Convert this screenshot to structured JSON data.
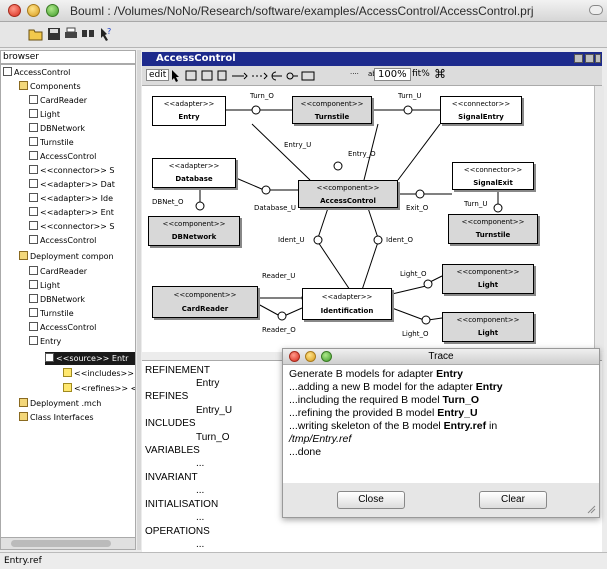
{
  "window": {
    "title": "Bouml : /Volumes/NoNo/Research/software/examples/AccessControl/AccessControl.prj"
  },
  "toolbar": {
    "icons": [
      "open-icon",
      "save-icon",
      "print-icon",
      "find-icon",
      "help-icon"
    ]
  },
  "browser": {
    "label": "browser",
    "items": [
      {
        "label": "AccessControl"
      },
      {
        "label": "Components"
      },
      {
        "label": "CardReader"
      },
      {
        "label": "Light"
      },
      {
        "label": "DBNetwork"
      },
      {
        "label": "Turnstile"
      },
      {
        "label": "AccessControl"
      },
      {
        "label": "<<connector>> S"
      },
      {
        "label": "<<adapter>> Dat"
      },
      {
        "label": "<<adapter>> Ide"
      },
      {
        "label": "<<adapter>> Ent"
      },
      {
        "label": "<<connector>> S"
      },
      {
        "label": "AccessControl"
      },
      {
        "label": "Deployment compon"
      },
      {
        "label": "CardReader"
      },
      {
        "label": "Light"
      },
      {
        "label": "DBNetwork"
      },
      {
        "label": "Turnstile"
      },
      {
        "label": "AccessControl"
      },
      {
        "label": "Entry"
      },
      {
        "label": "<<source>> Entr"
      },
      {
        "label": "<<includes>>"
      },
      {
        "label": "<<refines>> <"
      },
      {
        "label": "Deployment .mch"
      },
      {
        "label": "Class Interfaces"
      }
    ]
  },
  "diagram": {
    "title": "AccessControl",
    "toolbar": {
      "edit": "edit",
      "zoom": "100%",
      "fit": "fit%"
    },
    "components": [
      {
        "stereo": "<<adapter>>",
        "name": "Entry"
      },
      {
        "stereo": "<<component>>",
        "name": "Turnstile"
      },
      {
        "stereo": "<<connector>>",
        "name": "SignalEntry"
      },
      {
        "stereo": "<<adapter>>",
        "name": "Database"
      },
      {
        "stereo": "<<component>>",
        "name": "AccessControl"
      },
      {
        "stereo": "<<connector>>",
        "name": "SignalExit"
      },
      {
        "stereo": "<<component>>",
        "name": "DBNetwork"
      },
      {
        "stereo": "<<component>>",
        "name": "Turnstile"
      },
      {
        "stereo": "<<component>>",
        "name": "Light"
      },
      {
        "stereo": "<<component>>",
        "name": "CardReader"
      },
      {
        "stereo": "<<adapter>>",
        "name": "Identification"
      },
      {
        "stereo": "<<component>>",
        "name": "Light"
      }
    ],
    "labels": [
      "Turn_O",
      "Turn_U",
      "Entry_U",
      "Entry_O",
      "DBNet_O",
      "Database_U",
      "Exit_O",
      "Turn_U",
      "Ident_U",
      "Ident_O",
      "Reader_U",
      "Reader_O",
      "Light_O",
      "Light_O"
    ]
  },
  "lower_panel": {
    "lines": [
      "REFINEMENT",
      "Entry",
      "REFINES",
      "Entry_U",
      "INCLUDES",
      "Turn_O",
      "VARIABLES",
      "...",
      "INVARIANT",
      "...",
      "INITIALISATION",
      "...",
      "OPERATIONS",
      "..."
    ]
  },
  "trace": {
    "title": "Trace",
    "lines": [
      {
        "pre": "Generate B models for adapter ",
        "bold": "Entry",
        "post": "",
        "italic": false
      },
      {
        "pre": "...adding a new B model for the adapter ",
        "bold": "Entry",
        "post": "",
        "italic": false
      },
      {
        "pre": "...including the required B model ",
        "bold": "Turn_O",
        "post": "",
        "italic": false
      },
      {
        "pre": "...refining the provided B model ",
        "bold": "Entry_U",
        "post": "",
        "italic": false
      },
      {
        "pre": "...writing skeleton of the B model ",
        "bold": "Entry.ref",
        "post": " in",
        "italic": false
      },
      {
        "pre": "/tmp/Entry.ref",
        "bold": "",
        "post": "",
        "italic": true
      },
      {
        "pre": "...done",
        "bold": "",
        "post": "",
        "italic": false
      }
    ],
    "close_label": "Close",
    "clear_label": "Clear"
  },
  "status": {
    "text": "Entry.ref"
  }
}
